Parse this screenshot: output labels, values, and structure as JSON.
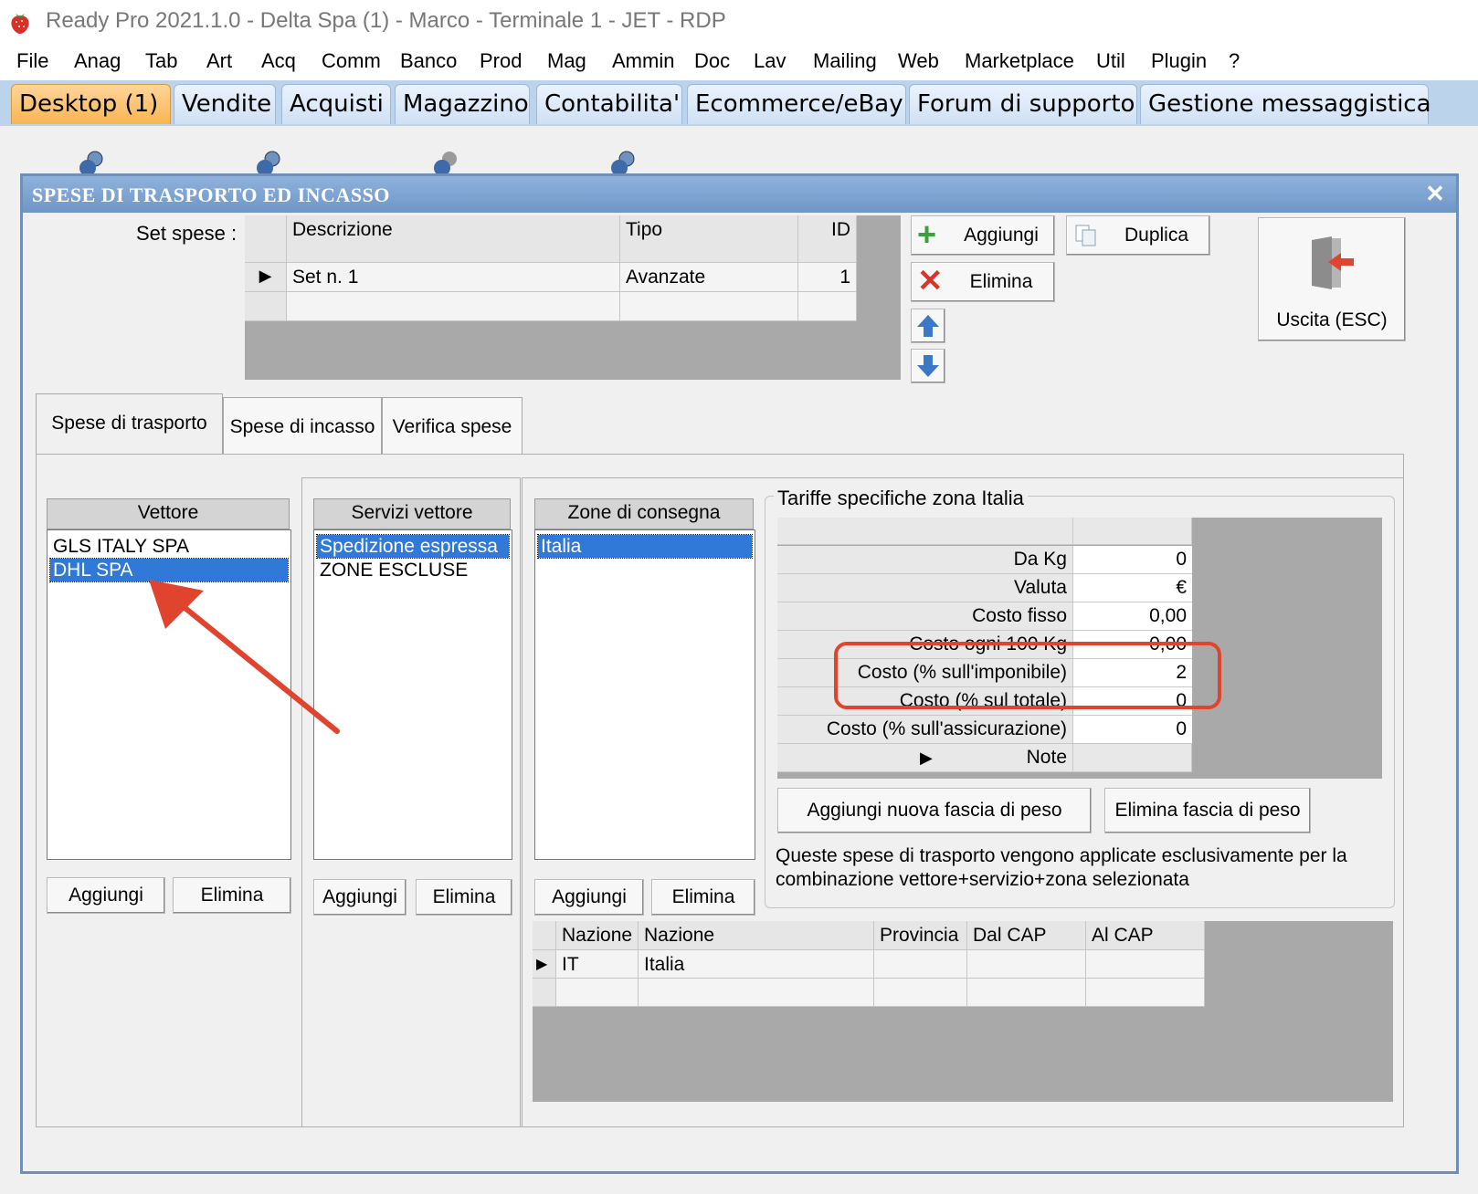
{
  "window": {
    "title": "Ready Pro 2021.1.0 - Delta Spa (1) - Marco - Terminale 1 - JET - RDP"
  },
  "menu": [
    "File",
    "Anag",
    "Tab",
    "Art",
    "Acq",
    "Comm",
    "Banco",
    "Prod",
    "Mag",
    "Ammin",
    "Doc",
    "Lav",
    "Mailing",
    "Web",
    "Marketplace",
    "Util",
    "Plugin",
    "?"
  ],
  "tabs": [
    "Desktop (1)",
    "Vendite",
    "Acquisti",
    "Magazzino",
    "Contabilita'",
    "Ecommerce/eBay",
    "Forum di supporto",
    "Gestione messaggistica"
  ],
  "dialog": {
    "title": "SPESE DI TRASPORTO ED INCASSO",
    "set_label": "Set spese :",
    "set_grid": {
      "headers": [
        "Descrizione",
        "Tipo",
        "ID"
      ],
      "rows": [
        [
          "Set n. 1",
          "Avanzate",
          "1"
        ]
      ]
    },
    "buttons": {
      "aggiungi": "Aggiungi",
      "duplica": "Duplica",
      "elimina": "Elimina",
      "uscita": "Uscita (ESC)"
    },
    "subtabs": [
      "Spese di trasporto",
      "Spese di incasso",
      "Verifica spese"
    ],
    "vettore": {
      "header": "Vettore",
      "items": [
        "GLS ITALY SPA",
        "DHL SPA"
      ],
      "selected": "DHL SPA",
      "add": "Aggiungi",
      "remove": "Elimina"
    },
    "servizi": {
      "header": "Servizi vettore",
      "items": [
        "Spedizione espressa",
        "ZONE ESCLUSE"
      ],
      "selected": "Spedizione espressa",
      "add": "Aggiungi",
      "remove": "Elimina"
    },
    "zone": {
      "header": "Zone di consegna",
      "items": [
        "Italia"
      ],
      "selected": "Italia",
      "add": "Aggiungi",
      "remove": "Elimina"
    },
    "tariffe": {
      "title": "Tariffe specifiche zona Italia",
      "rows": [
        {
          "label": "Da Kg",
          "value": "0"
        },
        {
          "label": "Valuta",
          "value": "€"
        },
        {
          "label": "Costo fisso",
          "value": "0,00"
        },
        {
          "label": "Costo ogni 100 Kg",
          "value": "0,00"
        },
        {
          "label": "Costo (% sull'imponibile)",
          "value": "2"
        },
        {
          "label": "Costo (% sul totale)",
          "value": "0"
        },
        {
          "label": "Costo (% sull'assicurazione)",
          "value": "0"
        },
        {
          "label": "Note",
          "value": ""
        }
      ],
      "add_band": "Aggiungi nuova fascia di peso",
      "remove_band": "Elimina fascia di peso",
      "note_text": "Queste spese di trasporto vengono applicate esclusivamente per la combinazione vettore+servizio+zona selezionata"
    },
    "zone_grid": {
      "headers": [
        "Nazione",
        "Nazione",
        "Provincia",
        "Dal CAP",
        "Al CAP"
      ],
      "rows": [
        [
          "IT",
          "Italia",
          "",
          "",
          ""
        ]
      ]
    }
  },
  "colors": {
    "highlight_box": "#e0442f",
    "arrow": "#e0442f",
    "selection": "#3079d8",
    "active_tab": "#f9b550"
  }
}
